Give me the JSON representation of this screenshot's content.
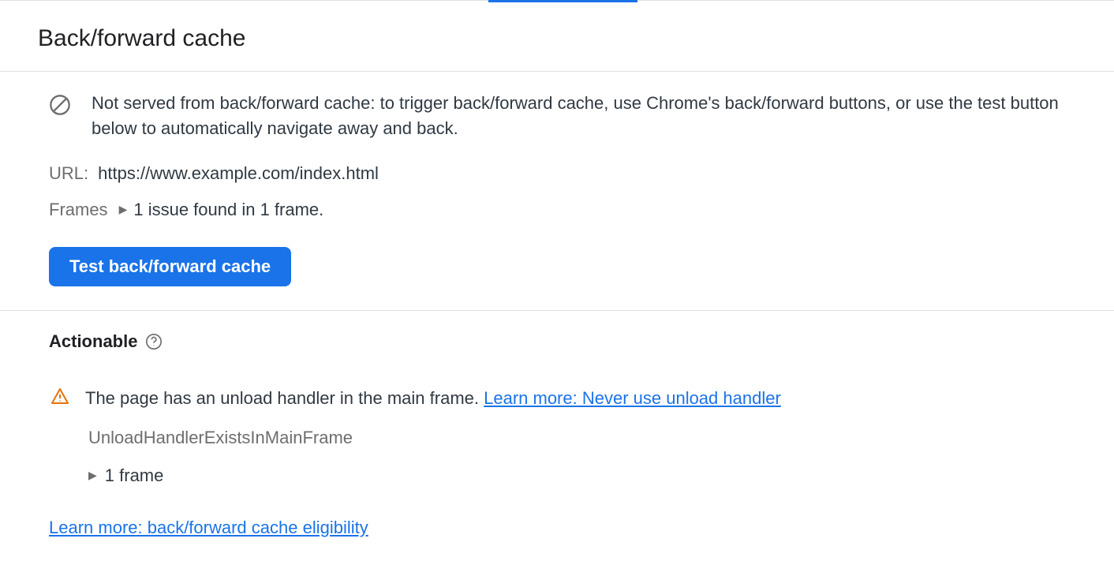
{
  "header": {
    "title": "Back/forward cache"
  },
  "info": {
    "message": "Not served from back/forward cache: to trigger back/forward cache, use Chrome's back/forward buttons, or use the test button below to automatically navigate away and back."
  },
  "url": {
    "label": "URL:",
    "value": "https://www.example.com/index.html"
  },
  "frames": {
    "label": "Frames",
    "summary": "1 issue found in 1 frame."
  },
  "button": {
    "test": "Test back/forward cache"
  },
  "actionable": {
    "heading": "Actionable",
    "issue_text": "The page has an unload handler in the main frame. ",
    "issue_link": "Learn more: Never use unload handler",
    "issue_code": "UnloadHandlerExistsInMainFrame",
    "frame_count": "1 frame"
  },
  "bottom_link": "Learn more: back/forward cache eligibility"
}
